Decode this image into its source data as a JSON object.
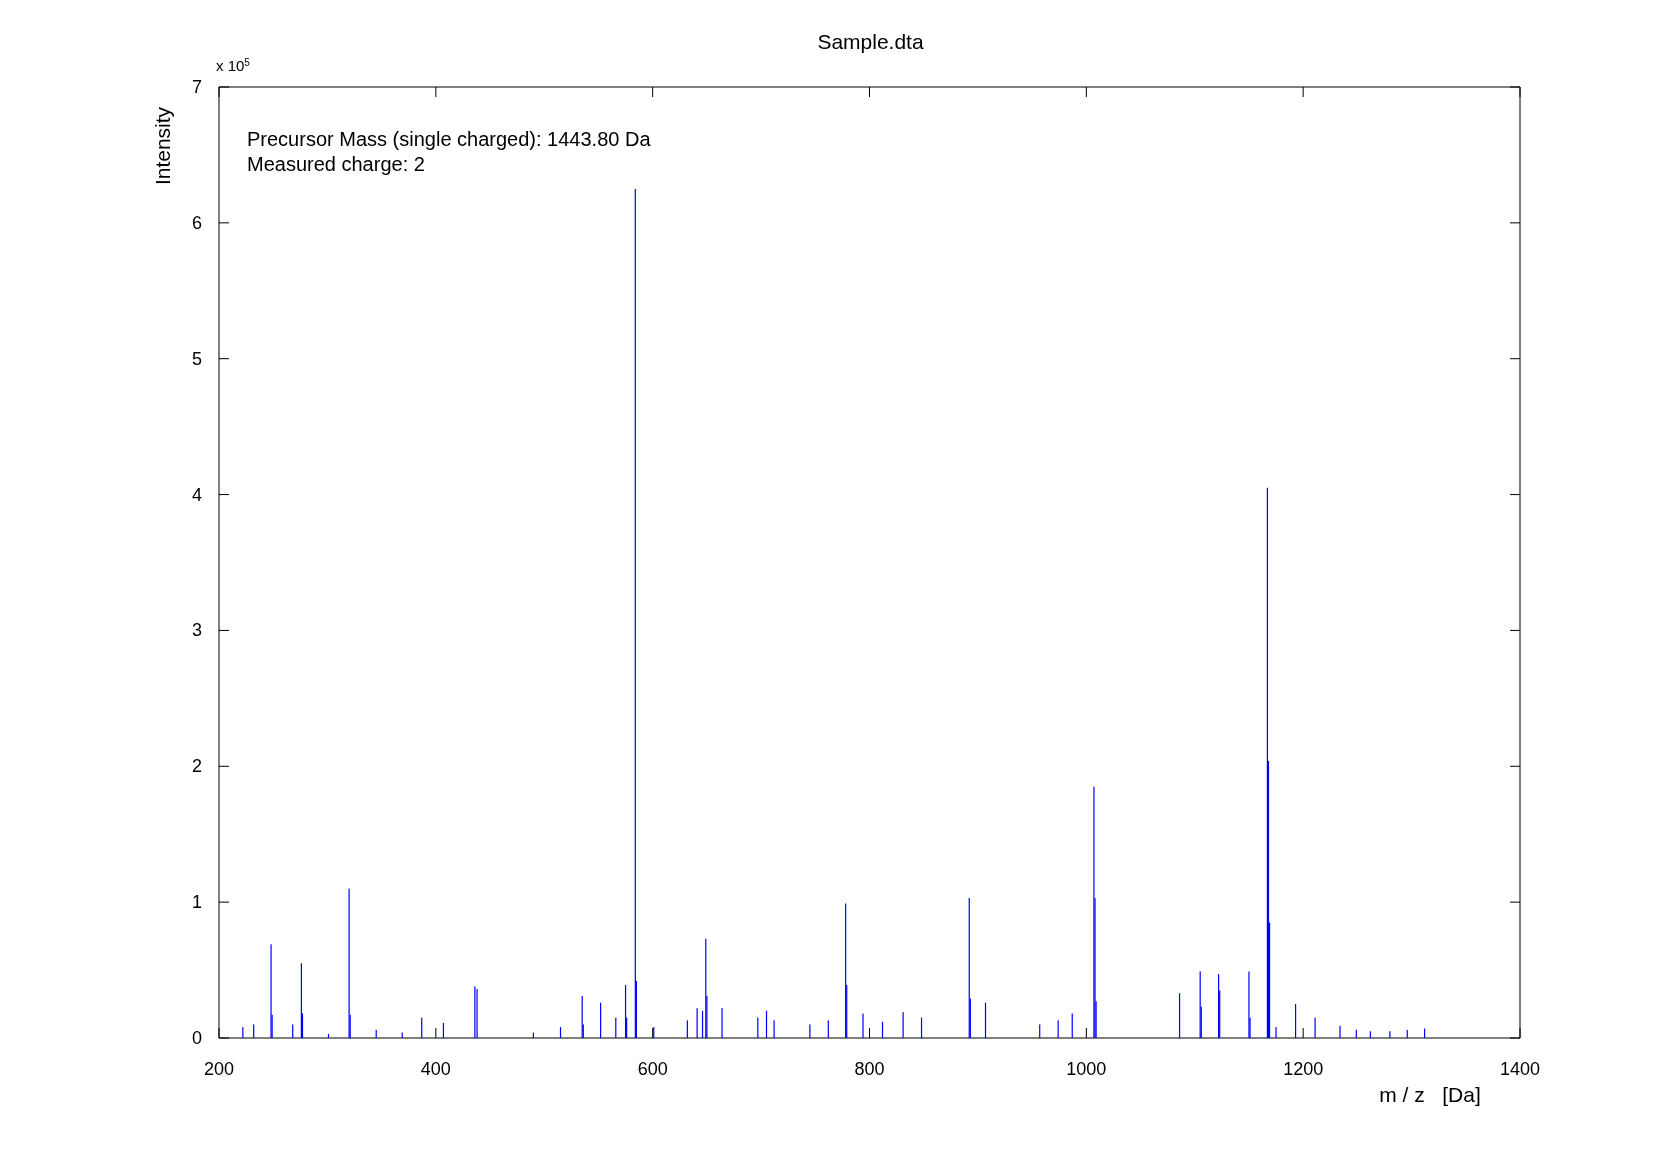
{
  "figure": {
    "y_multiplier": "x 10$^{5}$",
    "chart_data": {
      "type": "bar",
      "title": "Sample.dta",
      "xlabel": "m / z   [Da]",
      "ylabel": "Intensity",
      "x": [
        222,
        232,
        248,
        249,
        268,
        276,
        277,
        301,
        320,
        321,
        345,
        369,
        387,
        407,
        436,
        438,
        490,
        515,
        535,
        536,
        552,
        566,
        575,
        576,
        584,
        585,
        601,
        632,
        641,
        646,
        649,
        650,
        664,
        697,
        705,
        712,
        745,
        762,
        778,
        779,
        794,
        812,
        831,
        848,
        892,
        893,
        907,
        957,
        974,
        987,
        1007,
        1008,
        1009,
        1086,
        1105,
        1106,
        1122,
        1123,
        1150,
        1151,
        1167,
        1168,
        1169,
        1175,
        1193,
        1211,
        1234,
        1249,
        1262,
        1280,
        1296,
        1312
      ],
      "series": [
        {
          "color": "#0000ff",
          "values": [
            0.08,
            0.1,
            0.69,
            0.17,
            0.1,
            0.55,
            0.18,
            0.03,
            1.1,
            0.17,
            0.06,
            0.04,
            0.15,
            0.11,
            0.38,
            0.36,
            0.04,
            0.08,
            0.31,
            0.1,
            0.26,
            0.15,
            0.39,
            0.15,
            6.25,
            0.42,
            0.08,
            0.13,
            0.22,
            0.2,
            0.73,
            0.31,
            0.22,
            0.15,
            0.2,
            0.13,
            0.1,
            0.13,
            0.99,
            0.39,
            0.18,
            0.12,
            0.19,
            0.15,
            1.03,
            0.29,
            0.26,
            0.1,
            0.13,
            0.18,
            1.85,
            1.03,
            0.27,
            0.33,
            0.49,
            0.23,
            0.47,
            0.35,
            0.49,
            0.15,
            4.05,
            2.04,
            0.85,
            0.08,
            0.25,
            0.15,
            0.09,
            0.06,
            0.05,
            0.05,
            0.06,
            0.07
          ]
        }
      ],
      "xlim": [
        200,
        1400
      ],
      "ylim": [
        0,
        7
      ],
      "xticks": [
        200,
        400,
        600,
        800,
        1000,
        1200,
        1400
      ],
      "yticks": [
        0,
        1,
        2,
        3,
        4,
        5,
        6,
        7
      ],
      "annotations": [
        "Precursor Mass (single charged): 1443.80 Da",
        "Measured charge: 2"
      ]
    }
  }
}
